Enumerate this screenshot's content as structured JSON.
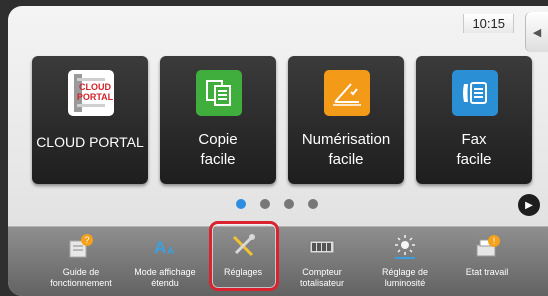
{
  "status": {
    "time": "10:15",
    "side_tab_icon": "chevron-left-icon"
  },
  "tiles": [
    {
      "id": "cloud-portal",
      "label": "CLOUD PORTAL",
      "icon": "cloud-portal-logo",
      "logo_text_1": "CLOUD",
      "logo_text_2": "PORTAL"
    },
    {
      "id": "copie-facile",
      "label": "Copie\nfacile",
      "icon": "copy-icon",
      "accent": "#3fae3c"
    },
    {
      "id": "numerisation-facile",
      "label": "Numérisation\nfacile",
      "icon": "scan-icon",
      "accent": "#f39a18"
    },
    {
      "id": "fax-facile",
      "label": "Fax\nfacile",
      "icon": "fax-icon",
      "accent": "#2b8fd6"
    }
  ],
  "pager": {
    "pages": 4,
    "current": 1,
    "next_icon": "play-icon"
  },
  "bottom_bar": [
    {
      "id": "guide",
      "label": "Guide de\nfonctionnement",
      "icon": "guide-icon"
    },
    {
      "id": "mode-affichage",
      "label": "Mode affichage\nétendu",
      "icon": "text-size-icon"
    },
    {
      "id": "reglages",
      "label": "Réglages",
      "icon": "settings-tools-icon",
      "highlighted": true
    },
    {
      "id": "compteur",
      "label": "Compteur\ntotalisateur",
      "icon": "counter-icon"
    },
    {
      "id": "luminosite",
      "label": "Réglage de\nluminosité",
      "icon": "brightness-icon"
    },
    {
      "id": "etat-travail",
      "label": "Etat travail",
      "icon": "job-status-icon"
    }
  ],
  "colors": {
    "highlight": "#d9232f",
    "active_dot": "#2d8ee0"
  }
}
